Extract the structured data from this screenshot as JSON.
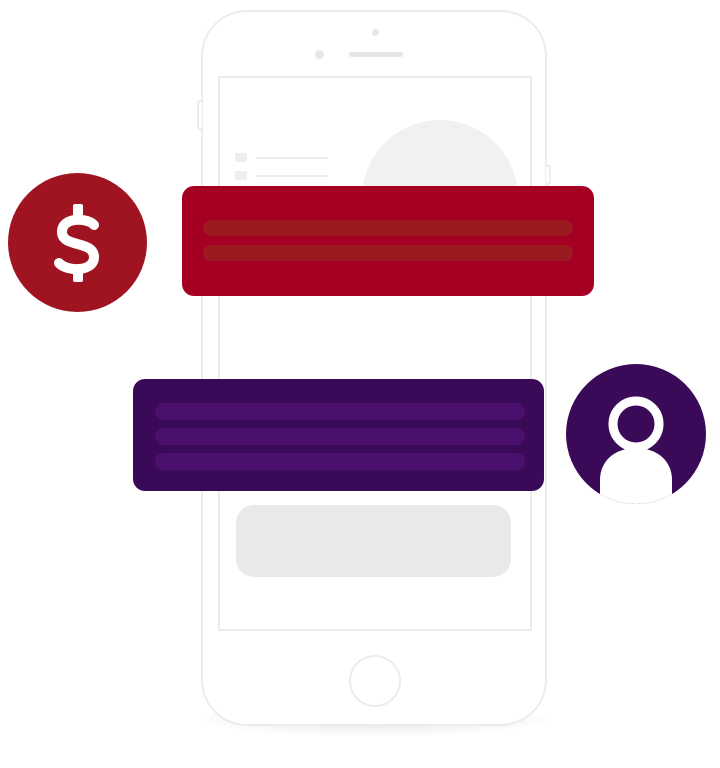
{
  "illustration": {
    "colors": {
      "phone_outline": "#ececec",
      "screen_placeholder": "#e9e9e9",
      "red_card": "#a50024",
      "red_card_lines": "#9b1a20",
      "purple_card": "#3a0a59",
      "purple_card_lines": "#4b106e",
      "dollar_badge": "#9f1420",
      "user_badge": "#3a0a59",
      "icon_fill": "#ffffff"
    },
    "icons": {
      "payment": "dollar-icon",
      "user": "user-icon"
    },
    "message_cards": [
      {
        "color": "red",
        "text_line_count": 2
      },
      {
        "color": "purple",
        "text_line_count": 3
      }
    ]
  }
}
